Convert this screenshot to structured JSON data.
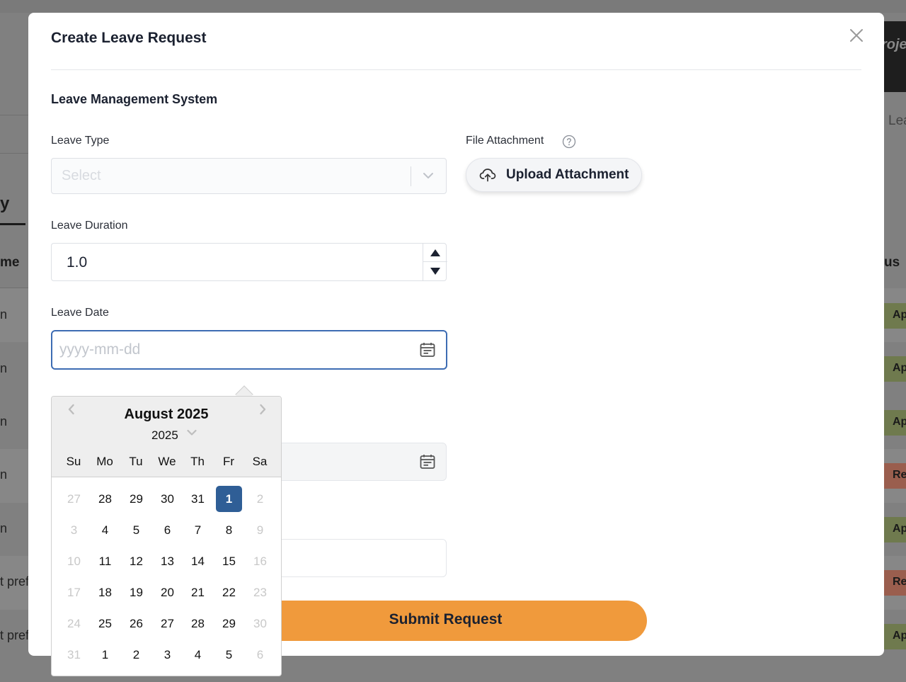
{
  "modal": {
    "title": "Create Leave Request",
    "section_title": "Leave Management System"
  },
  "form": {
    "leave_type": {
      "label": "Leave Type",
      "placeholder": "Select"
    },
    "leave_duration": {
      "label": "Leave Duration",
      "value": "1.0"
    },
    "leave_date": {
      "label": "Leave Date",
      "placeholder": "yyyy-mm-dd"
    },
    "attachment": {
      "label": "File Attachment",
      "button_label": "Upload Attachment"
    },
    "submit_label": "Submit Request"
  },
  "datepicker": {
    "month_label": "August 2025",
    "year": "2025",
    "weekdays": [
      "Su",
      "Mo",
      "Tu",
      "We",
      "Th",
      "Fr",
      "Sa"
    ],
    "weeks": [
      [
        "27",
        "28",
        "29",
        "30",
        "31",
        "1",
        "2"
      ],
      [
        "3",
        "4",
        "5",
        "6",
        "7",
        "8",
        "9"
      ],
      [
        "10",
        "11",
        "12",
        "13",
        "14",
        "15",
        "16"
      ],
      [
        "17",
        "18",
        "19",
        "20",
        "21",
        "22",
        "23"
      ],
      [
        "24",
        "25",
        "26",
        "27",
        "28",
        "29",
        "30"
      ],
      [
        "31",
        "1",
        "2",
        "3",
        "4",
        "5",
        "6"
      ]
    ],
    "selected_day": "1"
  },
  "background": {
    "tab_title_fragment": "y",
    "column_header_fragment": "me",
    "status_header_fragment": "us",
    "project_fragment": "roje",
    "leave_fragment": "Lea",
    "row_text_fragments": [
      "n",
      "n",
      "n",
      "n",
      "n",
      "t pref",
      "t pref"
    ],
    "status_badges": [
      "Ap",
      "Ap",
      "Ap",
      "Re",
      "Ap",
      "Re",
      "Ap"
    ]
  },
  "colors": {
    "accent": "#f09a3c",
    "primary": "#2f5e96",
    "focus_border": "#3d6cb3",
    "approved_badge": "#6f7a4e",
    "rejected_badge": "#9a5e4e"
  }
}
